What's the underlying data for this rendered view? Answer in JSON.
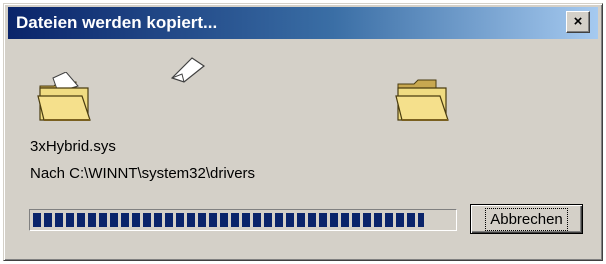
{
  "window": {
    "title": "Dateien werden kopiert...",
    "close_glyph": "×"
  },
  "icons": {
    "source": "folder-open-icon",
    "destination": "folder-open-icon",
    "animation": "flying-document-icon"
  },
  "file": {
    "name": "3xHybrid.sys",
    "destination": "Nach C:\\WINNT\\system32\\drivers"
  },
  "progress": {
    "fraction": 0.93,
    "color": "#0a246a"
  },
  "buttons": {
    "cancel_label": "Abbrechen"
  },
  "colors": {
    "title_start": "#0a246a",
    "title_end": "#a6caf0",
    "face": "#d4d0c8"
  }
}
